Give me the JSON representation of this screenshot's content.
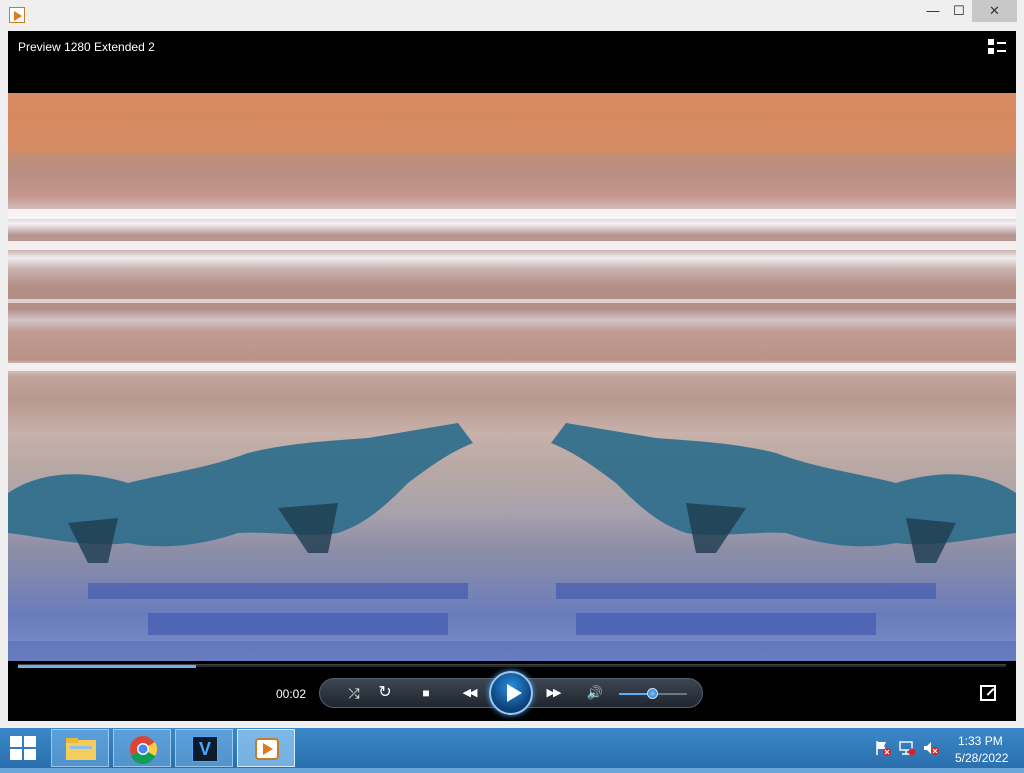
{
  "window": {
    "minimize_glyph": "—",
    "maximize_glyph": "☐",
    "close_glyph": "✕"
  },
  "player": {
    "title": "Preview 1280 Extended 2",
    "elapsed": "00:02",
    "seek_progress_percent": 18,
    "volume_percent": 50,
    "accent_color": "#3b8fe0"
  },
  "controls": {
    "shuffle_glyph": "⤮",
    "repeat_glyph": "↻",
    "stop_glyph": "■",
    "previous_glyph": "◀◀",
    "next_glyph": "▶▶",
    "mute_glyph": "🔊"
  },
  "taskbar": {
    "apps": [
      {
        "name": "file-explorer-icon"
      },
      {
        "name": "chrome-icon"
      },
      {
        "name": "vegas-icon",
        "letter": "V"
      },
      {
        "name": "media-player-icon",
        "active": true
      }
    ],
    "tray_icons": [
      "action-center-flag-icon",
      "network-icon",
      "volume-muted-icon"
    ],
    "time": "1:33 PM",
    "date": "5/28/2022"
  }
}
